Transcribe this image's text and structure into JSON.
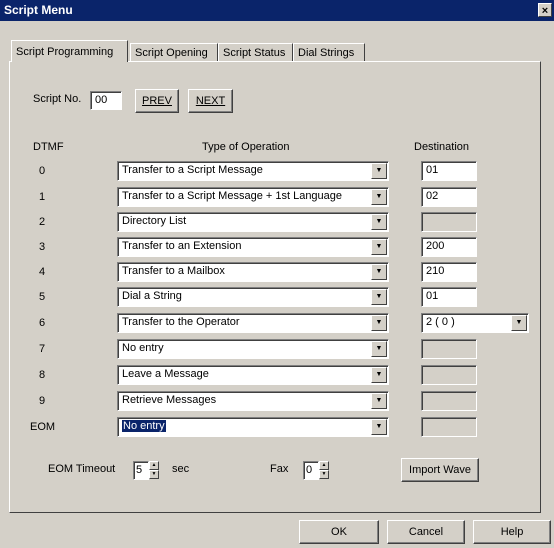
{
  "window": {
    "title": "Script Menu",
    "close_glyph": "×"
  },
  "tabs": [
    {
      "label": "Script Programming",
      "active": true
    },
    {
      "label": "Script Opening",
      "active": false
    },
    {
      "label": "Script Status",
      "active": false
    },
    {
      "label": "Dial Strings",
      "active": false
    }
  ],
  "script": {
    "label": "Script No.",
    "value": "00",
    "prev_label": "PREV",
    "next_label": "NEXT"
  },
  "headers": {
    "dtmf": "DTMF",
    "type": "Type of Operation",
    "destination": "Destination"
  },
  "rows": [
    {
      "dtmf": "0",
      "operation": "Transfer to a Script Message",
      "destination": "01"
    },
    {
      "dtmf": "1",
      "operation": "Transfer to a Script Message + 1st Language",
      "destination": "02"
    },
    {
      "dtmf": "2",
      "operation": "Directory List",
      "destination": ""
    },
    {
      "dtmf": "3",
      "operation": "Transfer to an Extension",
      "destination": "200"
    },
    {
      "dtmf": "4",
      "operation": "Transfer to a Mailbox",
      "destination": "210"
    },
    {
      "dtmf": "5",
      "operation": "Dial a String",
      "destination": "01"
    },
    {
      "dtmf": "6",
      "operation": "Transfer to the Operator",
      "destination": "2 ( 0 )"
    },
    {
      "dtmf": "7",
      "operation": "No entry",
      "destination": ""
    },
    {
      "dtmf": "8",
      "operation": "Leave a Message",
      "destination": ""
    },
    {
      "dtmf": "9",
      "operation": "Retrieve Messages",
      "destination": ""
    },
    {
      "dtmf": "EOM",
      "operation": "No entry",
      "destination": ""
    }
  ],
  "eom_timeout": {
    "label": "EOM Timeout",
    "value": "5",
    "unit": "sec"
  },
  "fax": {
    "label": "Fax",
    "value": "0"
  },
  "buttons": {
    "import_wave": "Import Wave",
    "ok": "OK",
    "cancel": "Cancel",
    "help": "Help"
  },
  "colors": {
    "title_bar": "#0a246a",
    "face": "#d4d0c8",
    "selection": "#0a246a"
  }
}
